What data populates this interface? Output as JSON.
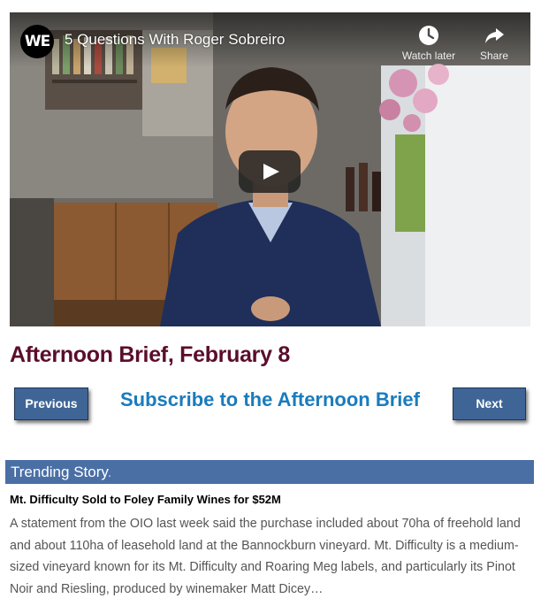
{
  "video": {
    "channel_logo_text": "WE",
    "title": "5 Questions With Roger Sobreiro",
    "watch_later_label": "Watch later",
    "share_label": "Share",
    "icons": {
      "watch_later": "clock-icon",
      "share": "share-arrow-icon",
      "play": "play-icon"
    }
  },
  "brief": {
    "title": "Afternoon Brief, February 8",
    "previous_label": "Previous",
    "subscribe_label": "Subscribe to the Afternoon Brief",
    "next_label": "Next"
  },
  "trending": {
    "label": "Trending Story",
    "label_suffix": ".",
    "story": {
      "headline": "Mt. Difficulty Sold to Foley Family Wines for $52M",
      "body": "A statement from the OIO last week said the purchase included about 70ha of freehold land and about 110ha of leasehold land at the Bannockburn vineyard. Mt. Difficulty is a medium-sized vineyard known for its Mt. Difficulty and Roaring Meg labels, and particularly its Pinot Noir and Riesling, produced by winemaker Matt Dicey…"
    }
  },
  "colors": {
    "brief_title": "#5b0d2b",
    "nav_button_bg": "#3e6596",
    "subscribe_link": "#1a7bbd",
    "trending_bar": "#4a6fa5",
    "body_text": "#555555"
  }
}
